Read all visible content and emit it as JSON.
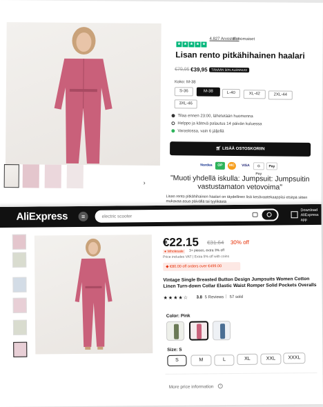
{
  "shop1": {
    "rating_text": "4.827 Arvostelut",
    "rating_badge": "Ennomaiset",
    "title": "Lisan rento pitkähihainen haalari",
    "old_price": "€79,95",
    "price": "€39,95",
    "sale_badge": "TÄNÄÄN 50% ALENNUS!",
    "size_label": "Koko: M-38",
    "sizes": [
      "S-36",
      "M-38",
      "L-40",
      "XL-42",
      "2XL-44",
      "3XL-46"
    ],
    "selected_size": "M-38",
    "perks": [
      "Tilaa ennen 23:00, lähetetään huomenna",
      "Helppo ja kätevä palautus 14 päivän kuluessa",
      "Varastossa, vain 6 jäljellä"
    ],
    "cart_button": "LISÄÄ OSTOSKORIIN",
    "payments": [
      "Nordea",
      "OP",
      "MC",
      "VISA",
      "G Pay",
      "Pay"
    ],
    "quote": "\"Muoti yhdellä iskulla: Jumpsuit: Jumpsuitin vastustamaton vetovoima\"",
    "description": "Lisan rento pitkähihainen haalari on täydellinen lisä kesävaatekaappiisi etsitpä sitten mukavaa asua päivällä tai tyylikästä",
    "arrow": "›"
  },
  "shop2": {
    "logo": "AliExpress",
    "menu_icon": "≡",
    "search_placeholder": "electric scooter",
    "header_right": "Download AliExpress app",
    "price": "€22.15",
    "old_price": "€31.64",
    "discount": "30% off",
    "wholesale_badge": "Wholesale",
    "wholesale_text": "3+ pieces, extra 3% off",
    "vat_text": "Price includes VAT | Extra 5% off with coins",
    "coupon": "€80.00 off orders over €499.00",
    "title": "Vintage Single Breasted Button Design Jumpsuits Women Cotton Linen Turn-down Collar Elastic Waist Romper Solid Pockets Overalls",
    "rating": "3.8",
    "reviews": "5 Reviews",
    "sold": "57 sold",
    "color_label": "Color: Pink",
    "size_label": "Size: S",
    "sizes": [
      "S",
      "M",
      "L",
      "XL",
      "XXL",
      "XXXL"
    ],
    "selected_size": "S",
    "more_price": "More price information"
  },
  "colors": {
    "pink": "#c9607a",
    "green": "#6b7a56",
    "blue": "#4b6f94",
    "ali_red": "#e62e04",
    "trustpilot": "#00b67a"
  }
}
